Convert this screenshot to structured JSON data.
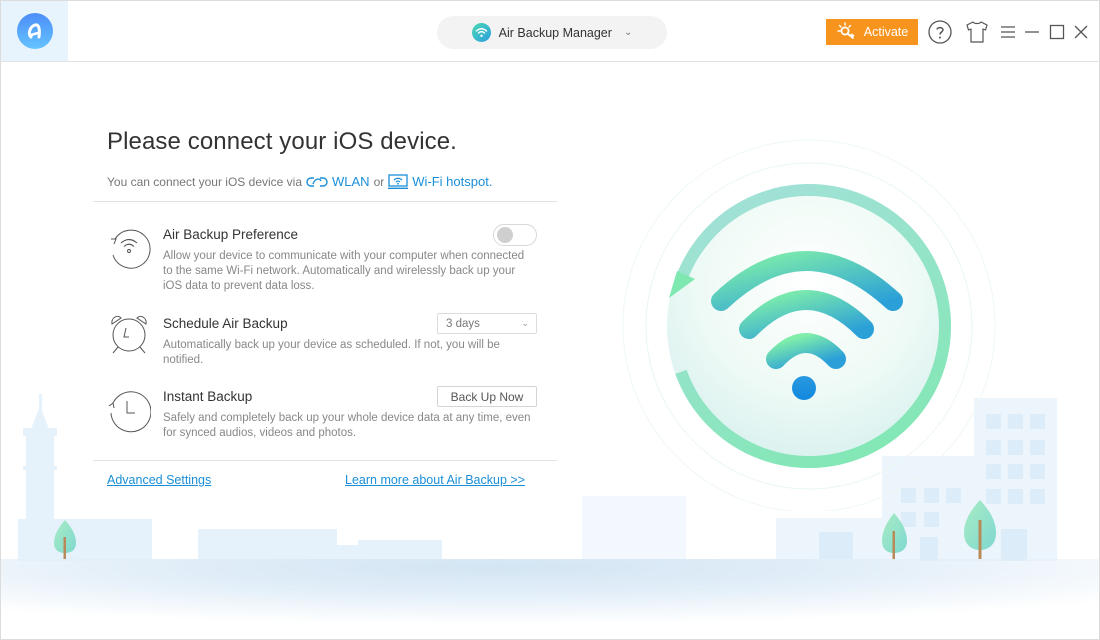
{
  "titlebar": {
    "device_selector_label": "Air Backup Manager",
    "activate_label": "Activate",
    "icons": [
      "app-logo-icon",
      "wifi-icon",
      "chevron-down-icon",
      "key-icon",
      "help-icon",
      "skin-shirt-icon",
      "menu-icon",
      "minimize-icon",
      "maximize-icon",
      "close-icon"
    ]
  },
  "main": {
    "heading": "Please connect your iOS device.",
    "subline_prefix": "You can connect your iOS device via",
    "wlan_link": "WLAN",
    "or_text": "or",
    "hotspot_link": "Wi-Fi hotspot.",
    "options": [
      {
        "title": "Air Backup Preference",
        "description": "Allow your device to communicate with your computer when connected to the same Wi-Fi network. Automatically and wirelessly back up your iOS data to prevent data loss.",
        "control": "toggle",
        "toggle_on": false
      },
      {
        "title": "Schedule Air Backup",
        "description": "Automatically back up your device as scheduled. If not, you will be notified.",
        "control": "select",
        "selected_value": "3 days"
      },
      {
        "title": "Instant Backup",
        "description": "Safely and completely back up your whole device data at any time, even for synced audios, videos and photos.",
        "control": "button",
        "button_label": "Back Up Now"
      }
    ],
    "advanced_settings_link": "Advanced Settings",
    "learn_more_link": "Learn more about Air Backup >>"
  },
  "colors": {
    "accent_blue": "#1a8fd8",
    "activate_orange": "#f7941d",
    "wifi_green": "#7ee8ad",
    "wifi_blue": "#1a8fe0"
  }
}
